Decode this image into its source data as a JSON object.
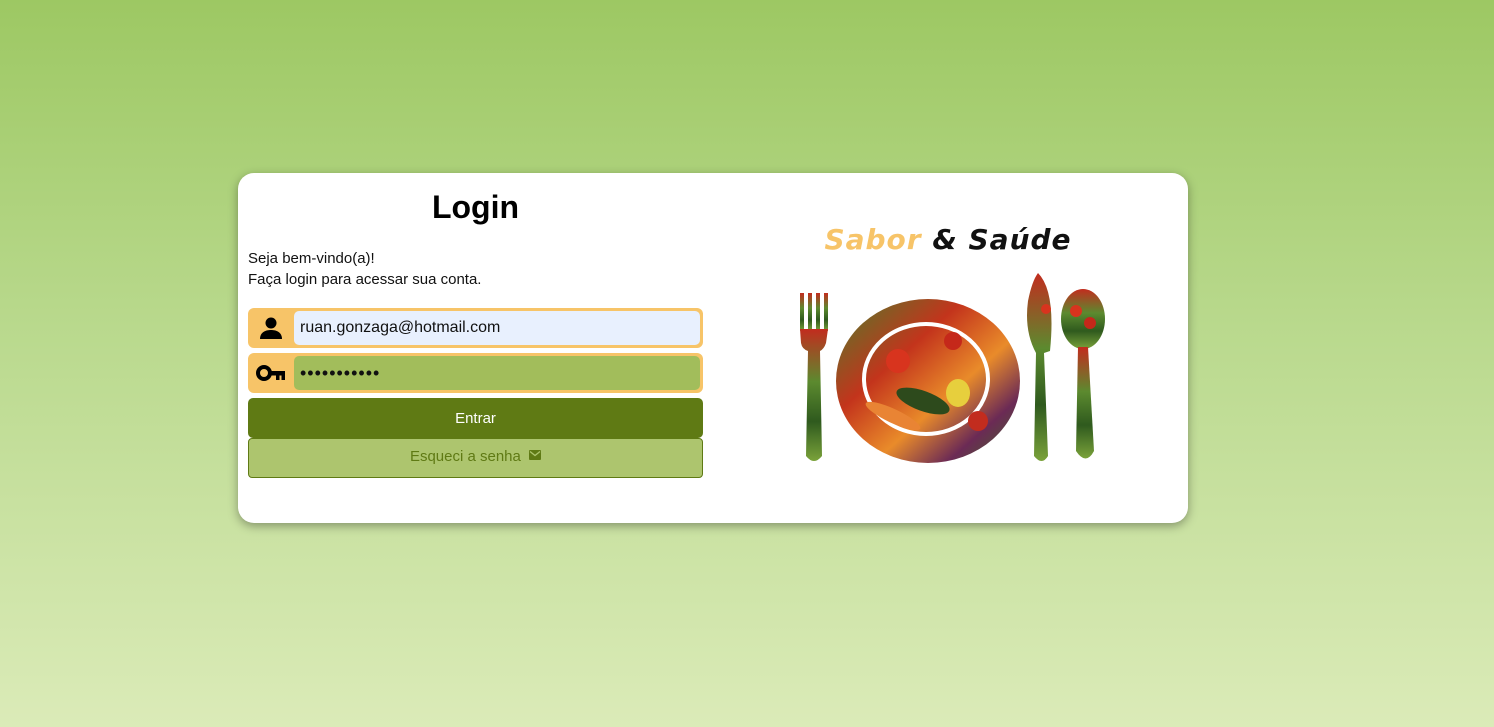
{
  "login": {
    "title": "Login",
    "welcome_line1": "Seja bem-vindo(a)!",
    "welcome_line2": "Faça login para acessar sua conta.",
    "email_value": "ruan.gonzaga@hotmail.com",
    "password_value": "•••••••••••",
    "enter_label": "Entrar",
    "forgot_label": "Esqueci a senha"
  },
  "brand": {
    "part1": "Sabor",
    "part2": "&",
    "part3": "Saúde"
  },
  "icons": {
    "user": "user-icon",
    "key": "key-icon",
    "mail": "mail-icon",
    "logo": "plate-cutlery-vegetables-logo"
  },
  "colors": {
    "background_top": "#9dc863",
    "background_bottom": "#dbebb8",
    "field_accent": "#f7c468",
    "primary_button": "#5f7a14",
    "secondary_button": "#adc56e",
    "brand_accent": "#f7c468"
  }
}
